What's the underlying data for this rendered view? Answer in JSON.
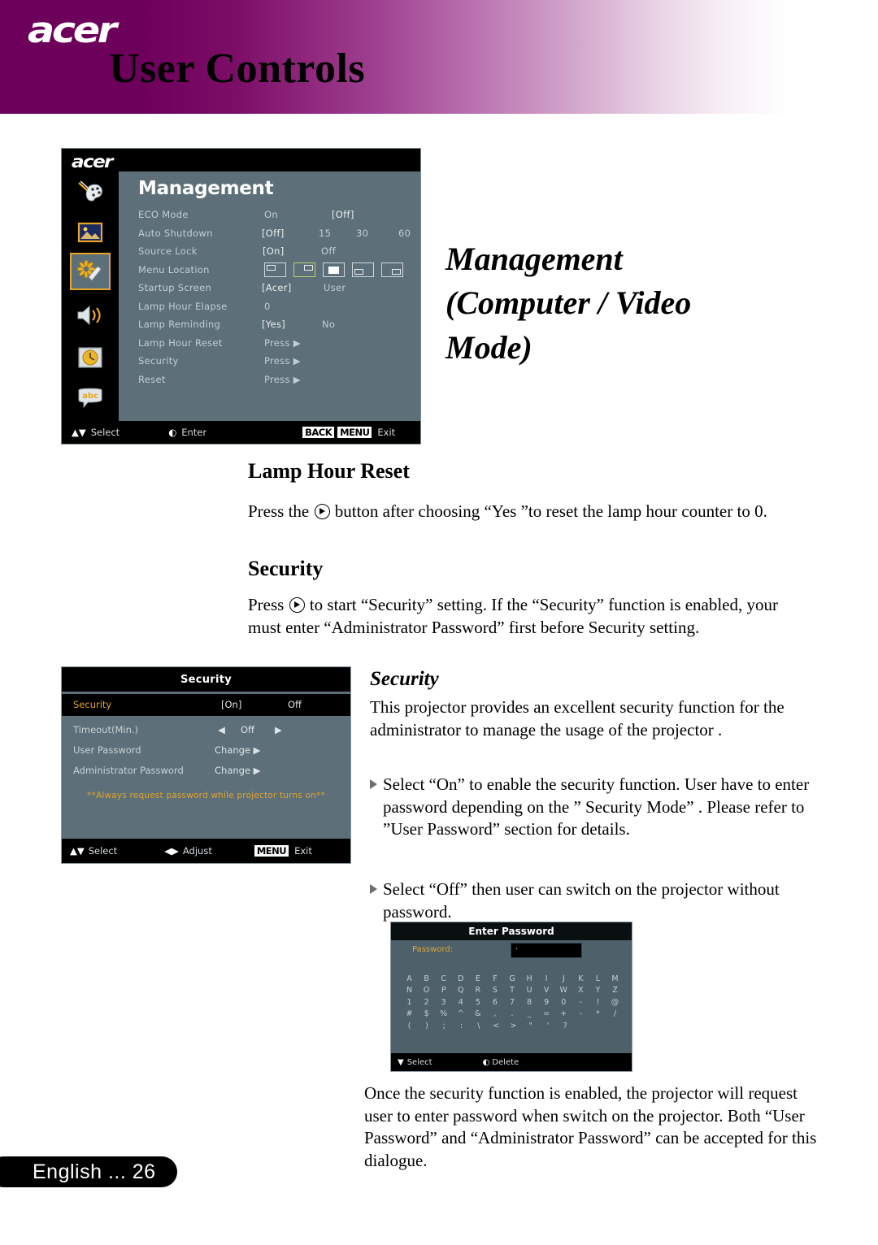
{
  "banner": {
    "logo": "acer",
    "title": "User Controls"
  },
  "management_osd": {
    "logo": "acer",
    "title": "Management",
    "sidebar_icons": [
      "color-palette-icon",
      "image-icon",
      "management-gear-icon",
      "audio-speaker-icon",
      "timer-clock-icon",
      "language-abc-icon"
    ],
    "active_icon_index": 2,
    "rows": [
      {
        "label": "ECO Mode",
        "values": [
          "On",
          "[Off]"
        ]
      },
      {
        "label": "Auto Shutdown",
        "values": [
          "[Off]",
          "15",
          "30",
          "60"
        ]
      },
      {
        "label": "Source Lock",
        "values": [
          "[On]",
          "Off"
        ]
      },
      {
        "label": "Menu Location",
        "values": []
      },
      {
        "label": "Startup Screen",
        "values": [
          "[Acer]",
          "User"
        ]
      },
      {
        "label": "Lamp Hour Elapse",
        "values": [
          "0"
        ]
      },
      {
        "label": "Lamp Reminding",
        "values": [
          "[Yes]",
          "No"
        ]
      },
      {
        "label": "Lamp Hour Reset",
        "values": [
          "Press ▶"
        ]
      },
      {
        "label": "Security",
        "values": [
          "Press ▶"
        ]
      },
      {
        "label": "Reset",
        "values": [
          "Press ▶"
        ]
      }
    ],
    "menu_location_options": [
      "top-left",
      "top-right",
      "center",
      "bottom-left",
      "bottom-right"
    ],
    "menu_location_selected": 1,
    "bottom_bar": {
      "select_label": "Select",
      "enter_label": "Enter",
      "back_key": "BACK",
      "menu_key": "MENU",
      "exit_label": "Exit"
    }
  },
  "security_osd": {
    "title": "Security",
    "selected_row": {
      "label": "Security",
      "value_on": "[On]",
      "value_off": "Off"
    },
    "rows": [
      {
        "label": "Timeout(Min.)",
        "value": "Off",
        "adjustable": true
      },
      {
        "label": "User Password",
        "value": "Change ▶",
        "adjustable": false
      },
      {
        "label": "Administrator Password",
        "value": "Change ▶",
        "adjustable": false
      }
    ],
    "note": "**Always request password while projector turns on**",
    "bottom_bar": {
      "select_label": "Select",
      "adjust_label": "Adjust",
      "menu_key": "MENU",
      "exit_label": "Exit"
    }
  },
  "password_osd": {
    "title": "Enter Password",
    "field_label": "Password:",
    "field_value": "·",
    "keyboard_rows": [
      [
        "A",
        "B",
        "C",
        "D",
        "E",
        "F",
        "G",
        "H",
        "I",
        "J",
        "K",
        "L",
        "M"
      ],
      [
        "N",
        "O",
        "P",
        "Q",
        "R",
        "S",
        "T",
        "U",
        "V",
        "W",
        "X",
        "Y",
        "Z"
      ],
      [
        "1",
        "2",
        "3",
        "4",
        "5",
        "6",
        "7",
        "8",
        "9",
        "0",
        "-",
        "!",
        "@"
      ],
      [
        "#",
        "$",
        "%",
        "^",
        "&",
        ",",
        ".",
        "_",
        "=",
        "+",
        "-",
        "*",
        "/"
      ],
      [
        "(",
        ")",
        ";",
        ":",
        "\\",
        "<",
        ">",
        "\"",
        "'",
        "?"
      ]
    ],
    "bottom_bar": {
      "select_label": "Select",
      "delete_label": "Delete"
    }
  },
  "document": {
    "main_heading_line1": "Management",
    "main_heading_line2": "(Computer / Video",
    "main_heading_line3": "Mode)",
    "lamp_hour_reset": {
      "heading": "Lamp Hour Reset",
      "text_before_button": "Press the",
      "text_after_button": "button after choosing “Yes ”to reset the lamp hour counter to 0."
    },
    "security_section": {
      "heading": "Security",
      "text_before_button": "Press",
      "text_after_button": "to start “Security” setting. If the “Security” function is enabled, your must enter “Administrator Password” first before Security setting."
    },
    "security_sub": {
      "heading": "Security",
      "intro": "This projector provides an excellent security function for the administrator to manage the usage of the projector .",
      "bullets": [
        "Select “On” to enable the security function. User have to enter password depending on the ” Security Mode” . Please refer to ”User Password” section for details.",
        "Select “Off” then user can switch on the projector without password."
      ],
      "closing": "Once the security function is enabled, the projector will request user to enter password when switch on the projector. Both “User Password” and “Administrator Password” can be accepted for this dialogue."
    }
  },
  "footer": {
    "page_label": "English ...   26"
  },
  "colors": {
    "banner_start": "#6d005b",
    "osd_panel": "#5d6f78",
    "osd_black": "#000000",
    "accent_gold": "#e0a52c",
    "active_border": "#e8a723"
  }
}
